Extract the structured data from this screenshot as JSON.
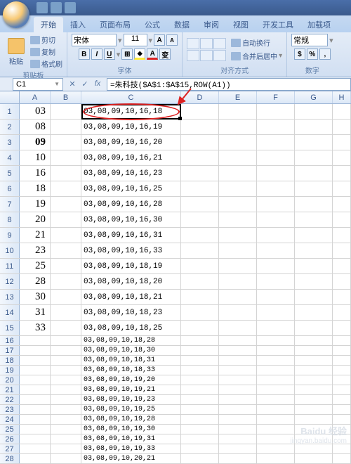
{
  "qat_tooltips": [
    "save",
    "undo",
    "redo"
  ],
  "tabs": {
    "items": [
      "开始",
      "插入",
      "页面布局",
      "公式",
      "数据",
      "审阅",
      "视图",
      "开发工具",
      "加载项"
    ],
    "active_index": 0
  },
  "ribbon": {
    "clipboard": {
      "title": "剪贴板",
      "paste": "粘贴",
      "cut": "剪切",
      "copy": "复制",
      "fmt": "格式刷"
    },
    "font": {
      "title": "字体",
      "name": "宋体",
      "size": "11",
      "bold": "B",
      "italic": "I",
      "underline": "U"
    },
    "align": {
      "title": "对齐方式",
      "wrap": "自动换行",
      "merge": "合并后居中"
    },
    "number": {
      "title": "数字",
      "fmt": "常规"
    }
  },
  "namebox": "C1",
  "formula": "=朱科技($A$1:$A$15,ROW(A1))",
  "columns": [
    "A",
    "B",
    "C",
    "D",
    "E",
    "F",
    "G",
    "H"
  ],
  "rows": [
    {
      "n": 1,
      "a": "03",
      "c": "03,08,09,10,16,18",
      "h": "tall"
    },
    {
      "n": 2,
      "a": "08",
      "c": "03,08,09,10,16,19",
      "h": "tall"
    },
    {
      "n": 3,
      "a": "09",
      "bold": true,
      "c": "03,08,09,10,16,20",
      "h": "tall"
    },
    {
      "n": 4,
      "a": "10",
      "c": "03,08,09,10,16,21",
      "h": "tall"
    },
    {
      "n": 5,
      "a": "16",
      "c": "03,08,09,10,16,23",
      "h": "tall"
    },
    {
      "n": 6,
      "a": "18",
      "c": "03,08,09,10,16,25",
      "h": "tall"
    },
    {
      "n": 7,
      "a": "19",
      "c": "03,08,09,10,16,28",
      "h": "tall"
    },
    {
      "n": 8,
      "a": "20",
      "c": "03,08,09,10,16,30",
      "h": "tall"
    },
    {
      "n": 9,
      "a": "21",
      "c": "03,08,09,10,16,31",
      "h": "tall"
    },
    {
      "n": 10,
      "a": "23",
      "c": "03,08,09,10,16,33",
      "h": "tall"
    },
    {
      "n": 11,
      "a": "25",
      "c": "03,08,09,10,18,19",
      "h": "tall"
    },
    {
      "n": 12,
      "a": "28",
      "c": "03,08,09,10,18,20",
      "h": "tall"
    },
    {
      "n": 13,
      "a": "30",
      "c": "03,08,09,10,18,21",
      "h": "tall"
    },
    {
      "n": 14,
      "a": "31",
      "c": "03,08,09,10,18,23",
      "h": "tall"
    },
    {
      "n": 15,
      "a": "33",
      "c": "03,08,09,10,18,25",
      "h": "tall"
    },
    {
      "n": 16,
      "a": "",
      "c": "03,08,09,10,18,28",
      "h": "short"
    },
    {
      "n": 17,
      "a": "",
      "c": "03,08,09,10,18,30",
      "h": "short"
    },
    {
      "n": 18,
      "a": "",
      "c": "03,08,09,10,18,31",
      "h": "short"
    },
    {
      "n": 19,
      "a": "",
      "c": "03,08,09,10,18,33",
      "h": "short"
    },
    {
      "n": 20,
      "a": "",
      "c": "03,08,09,10,19,20",
      "h": "short"
    },
    {
      "n": 21,
      "a": "",
      "c": "03,08,09,10,19,21",
      "h": "short"
    },
    {
      "n": 22,
      "a": "",
      "c": "03,08,09,10,19,23",
      "h": "short"
    },
    {
      "n": 23,
      "a": "",
      "c": "03,08,09,10,19,25",
      "h": "short"
    },
    {
      "n": 24,
      "a": "",
      "c": "03,08,09,10,19,28",
      "h": "short"
    },
    {
      "n": 25,
      "a": "",
      "c": "03,08,09,10,19,30",
      "h": "short"
    },
    {
      "n": 26,
      "a": "",
      "c": "03,08,09,10,19,31",
      "h": "short"
    },
    {
      "n": 27,
      "a": "",
      "c": "03,08,09,10,19,33",
      "h": "short"
    },
    {
      "n": 28,
      "a": "",
      "c": "03,08,09,10,20,21",
      "h": "short"
    }
  ],
  "watermark": {
    "brand": "Baidu 经验",
    "url": "jingyan.baidu.com"
  }
}
